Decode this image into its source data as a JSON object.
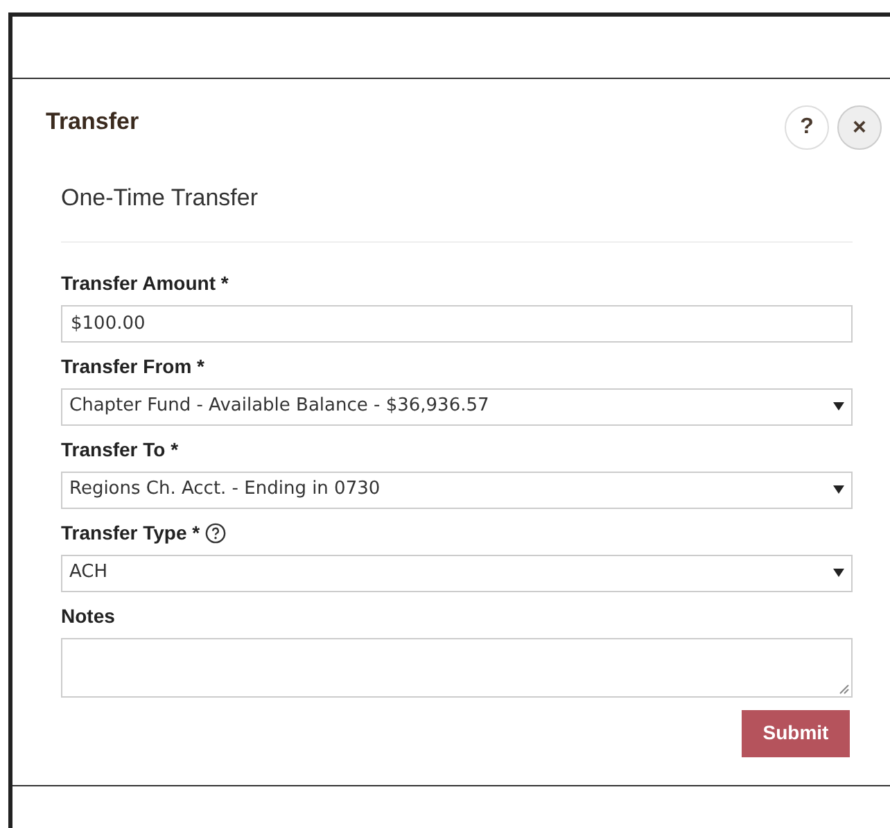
{
  "dialog": {
    "title": "Transfer",
    "help_button": "?",
    "close_button": "×"
  },
  "form": {
    "heading": "One-Time Transfer",
    "fields": [
      {
        "kind": "text",
        "label": "Transfer Amount *",
        "value": "$100.00",
        "help": false
      },
      {
        "kind": "select",
        "label": "Transfer From *",
        "value": "Chapter Fund - Available Balance - $36,936.57",
        "help": false
      },
      {
        "kind": "select",
        "label": "Transfer To *",
        "value": "Regions Ch. Acct. - Ending in 0730",
        "help": false
      },
      {
        "kind": "select",
        "label": "Transfer Type *",
        "value": "ACH",
        "help": true
      },
      {
        "kind": "textarea",
        "label": "Notes",
        "help": false
      }
    ],
    "submit": "Submit"
  }
}
